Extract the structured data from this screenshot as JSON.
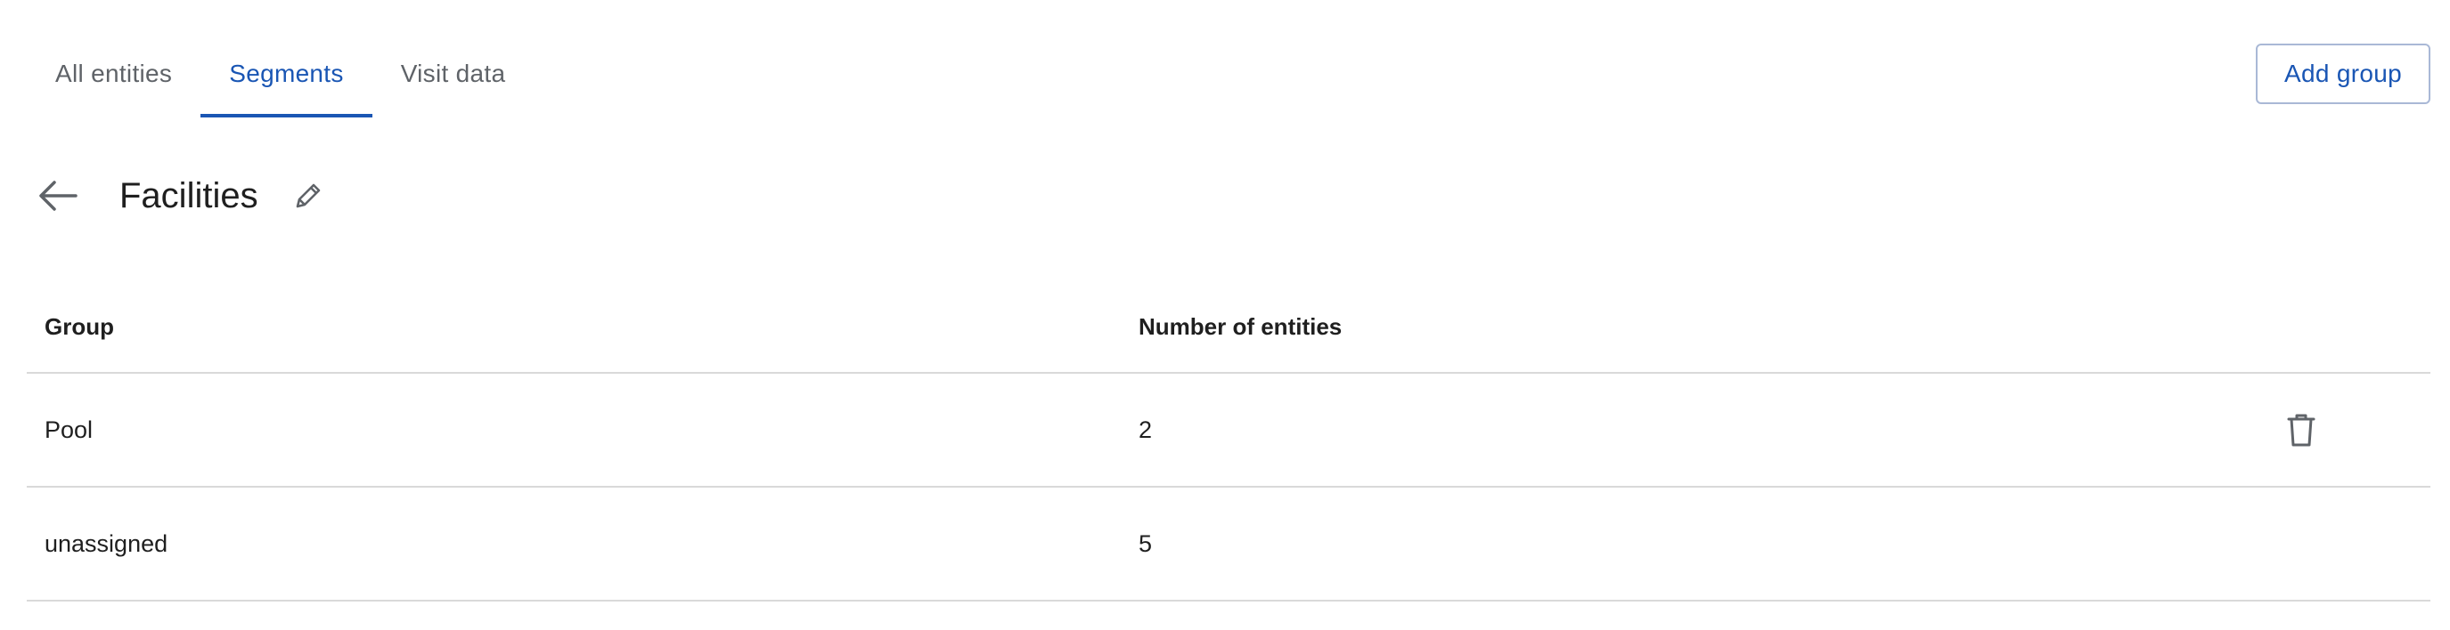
{
  "tabs": [
    {
      "label": "All entities",
      "active": false
    },
    {
      "label": "Segments",
      "active": true
    },
    {
      "label": "Visit data",
      "active": false
    }
  ],
  "actions": {
    "add_group_label": "Add group"
  },
  "header": {
    "title": "Facilities",
    "back_icon": "arrow-left-icon",
    "edit_icon": "pencil-icon"
  },
  "table": {
    "columns": [
      "Group",
      "Number of entities"
    ],
    "rows": [
      {
        "group": "Pool",
        "count": "2",
        "has_delete": true
      },
      {
        "group": "unassigned",
        "count": "5",
        "has_delete": false
      }
    ]
  },
  "colors": {
    "accent": "#1a56b4",
    "text": "#1f1f1f",
    "muted": "#5f6368",
    "divider": "#d9d9d9",
    "button_border": "#a9b8d6"
  }
}
